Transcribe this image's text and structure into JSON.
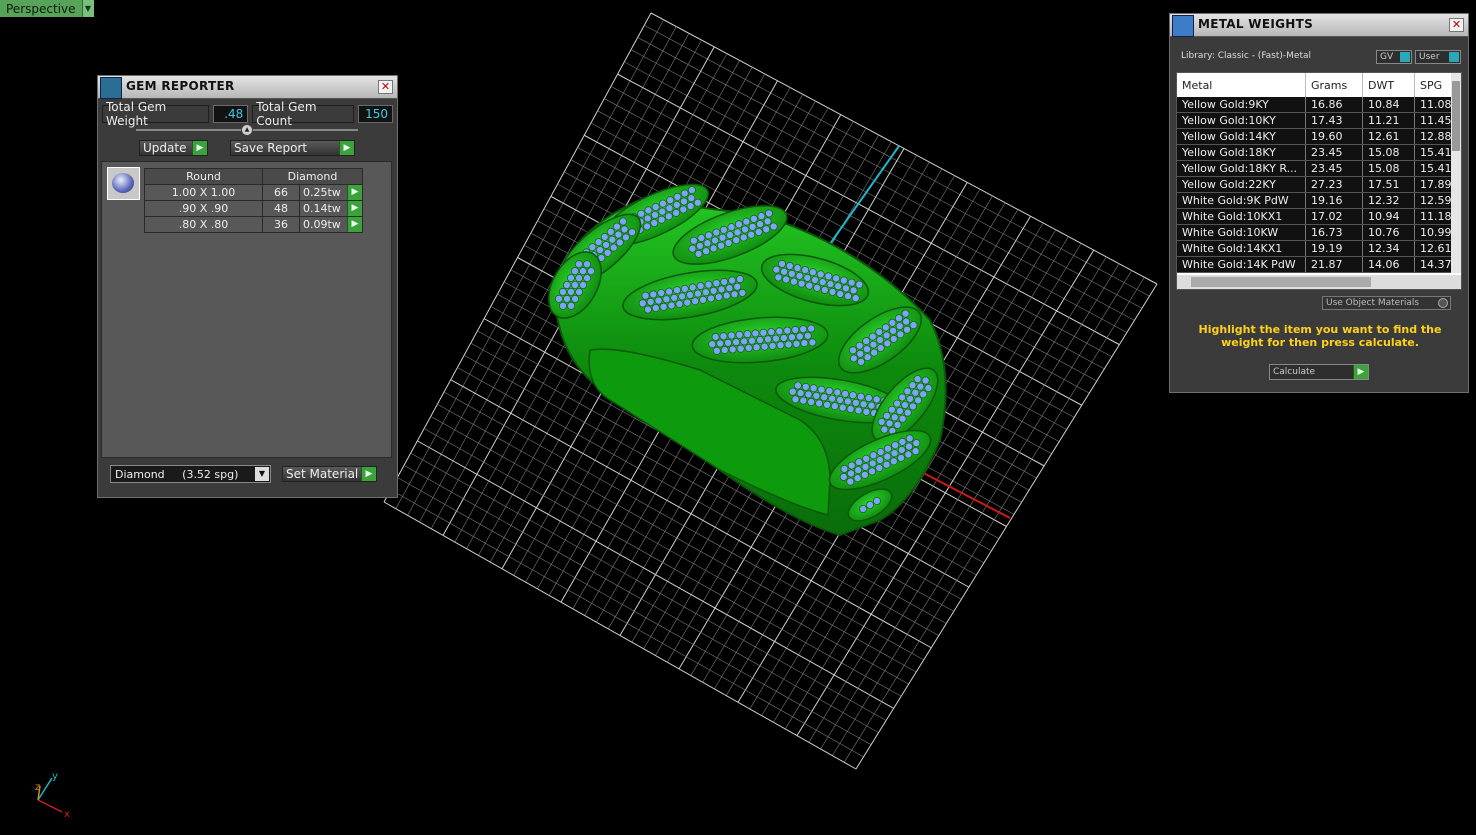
{
  "viewport": {
    "label": "Perspective",
    "dropdown_glyph": "▼"
  },
  "axis": {
    "x": "x",
    "y": "y",
    "z": "z"
  },
  "gem_reporter": {
    "title": "GEM REPORTER",
    "icon": "gem-reporter-icon",
    "close_glyph": "✕",
    "total_weight_label": "Total Gem Weight",
    "total_weight_value": ".48",
    "total_count_label": "Total Gem Count",
    "total_count_value": "150",
    "update_label": "Update",
    "save_report_label": "Save Report",
    "shape_header": "Round",
    "material_header": "Diamond",
    "rows": [
      {
        "size": "1.00 X 1.00",
        "count": "66",
        "tw": "0.25tw"
      },
      {
        "size": ".90 X .90",
        "count": "48",
        "tw": "0.14tw"
      },
      {
        "size": ".80 X .80",
        "count": "36",
        "tw": "0.09tw"
      }
    ],
    "material_select": "Diamond     (3.52 spg)",
    "set_material_label": "Set Material"
  },
  "metal_weights": {
    "title": "METAL WEIGHTS",
    "icon": "metal-weights-icon",
    "close_glyph": "✕",
    "library": "Library: Classic - (Fast)-Metal",
    "gv_label": "GV",
    "user_label": "User",
    "columns": [
      "Metal",
      "Grams",
      "DWT",
      "SPG"
    ],
    "rows": [
      [
        "Yellow Gold:9KY",
        "16.86",
        "10.84",
        "11.08"
      ],
      [
        "Yellow Gold:10KY",
        "17.43",
        "11.21",
        "11.45"
      ],
      [
        "Yellow Gold:14KY",
        "19.60",
        "12.61",
        "12.88"
      ],
      [
        "Yellow Gold:18KY",
        "23.45",
        "15.08",
        "15.41"
      ],
      [
        "Yellow Gold:18KY R...",
        "23.45",
        "15.08",
        "15.41"
      ],
      [
        "Yellow Gold:22KY",
        "27.23",
        "17.51",
        "17.89"
      ],
      [
        "White Gold:9K PdW",
        "19.16",
        "12.32",
        "12.59"
      ],
      [
        "White Gold:10KX1",
        "17.02",
        "10.94",
        "11.18"
      ],
      [
        "White Gold:10KW",
        "16.73",
        "10.76",
        "10.99"
      ],
      [
        "White Gold:14KX1",
        "19.19",
        "12.34",
        "12.61"
      ],
      [
        "White Gold:14K PdW",
        "21.87",
        "14.06",
        "14.37"
      ]
    ],
    "use_object_label": "Use Object Materials",
    "hint": "Highlight the item you want to find the weight for then press calculate.",
    "calculate_label": "Calculate"
  },
  "colors": {
    "model": "#119a11",
    "stones": "#7fa3ff",
    "grid": "#bdbdbd",
    "hint": "#ffd21c",
    "accent_value": "#45c8e6"
  }
}
